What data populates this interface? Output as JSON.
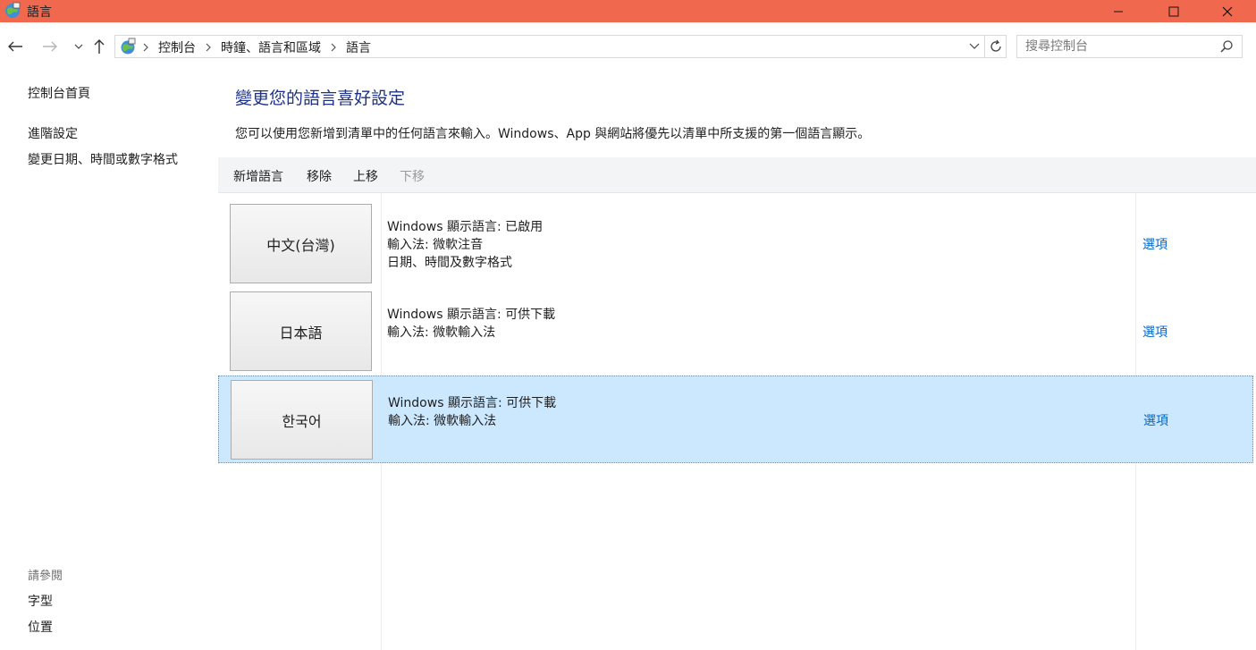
{
  "window": {
    "title": "語言",
    "title_bar_color": "#f0694f"
  },
  "address": {
    "breadcrumbs": [
      "控制台",
      "時鐘、語言和區域",
      "語言"
    ],
    "search_placeholder": "搜尋控制台"
  },
  "leftnav": {
    "home": "控制台首頁",
    "advanced": "進階設定",
    "datetime": "變更日期、時間或數字格式",
    "see_also": "請參閱",
    "fonts": "字型",
    "location": "位置"
  },
  "main": {
    "title": "變更您的語言喜好設定",
    "description": "您可以使用您新增到清單中的任何語言來輸入。Windows、App 與網站將優先以清單中所支援的第一個語言顯示。",
    "toolbar": {
      "add": "新增語言",
      "remove": "移除",
      "up": "上移",
      "down": "下移"
    },
    "languages": [
      {
        "name": "中文(台灣)",
        "details": [
          "Windows 顯示語言: 已啟用",
          "輸入法: 微軟注音",
          "日期、時間及數字格式"
        ],
        "options": "選項"
      },
      {
        "name": "日本語",
        "details": [
          "Windows 顯示語言: 可供下載",
          "輸入法: 微軟輸入法"
        ],
        "options": "選項"
      },
      {
        "name": "한국어",
        "details": [
          "Windows 顯示語言: 可供下載",
          "輸入法: 微軟輸入法"
        ],
        "options": "選項",
        "selected": true
      }
    ]
  },
  "colors": {
    "accent_title": "#1e3287",
    "link": "#0066cc",
    "selection": "#cce8ff"
  }
}
